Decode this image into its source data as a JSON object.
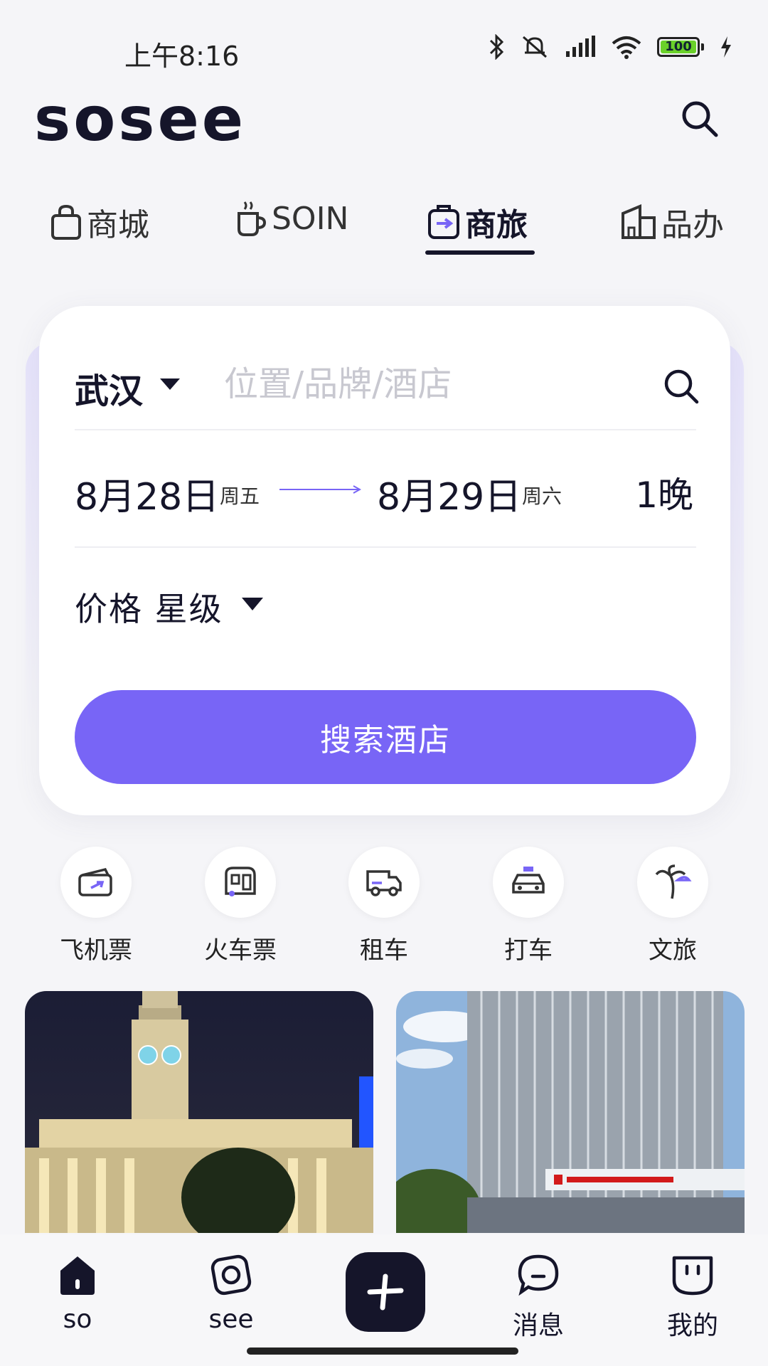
{
  "status_bar": {
    "time": "上午8:16",
    "battery": "100"
  },
  "header": {
    "logo": "sosee"
  },
  "tabs": [
    {
      "label": "商城",
      "icon": "shopping-bag-icon"
    },
    {
      "label": "SOIN",
      "icon": "coffee-cup-icon"
    },
    {
      "label": "商旅",
      "icon": "luggage-icon",
      "active": true
    },
    {
      "label": "品办",
      "icon": "office-building-icon"
    }
  ],
  "hotel_search": {
    "city": "武汉",
    "search_placeholder": "位置/品牌/酒店",
    "check_in_date": "8月28日",
    "check_in_weekday": "周五",
    "check_out_date": "8月29日",
    "check_out_weekday": "周六",
    "nights": "1晚",
    "filter_label": "价格 星级",
    "search_button": "搜索酒店",
    "accent_color": "#7865f6"
  },
  "services": [
    {
      "label": "飞机票",
      "icon": "flight-ticket-icon"
    },
    {
      "label": "火车票",
      "icon": "train-icon"
    },
    {
      "label": "租车",
      "icon": "car-rental-icon"
    },
    {
      "label": "打车",
      "icon": "taxi-icon"
    },
    {
      "label": "文旅",
      "icon": "palm-tree-icon"
    }
  ],
  "bottom_nav": [
    {
      "label": "so",
      "icon": "home-icon"
    },
    {
      "label": "see",
      "icon": "camera-icon"
    },
    {
      "label": "",
      "icon": "plus-icon"
    },
    {
      "label": "消息",
      "icon": "message-icon"
    },
    {
      "label": "我的",
      "icon": "profile-icon"
    }
  ]
}
